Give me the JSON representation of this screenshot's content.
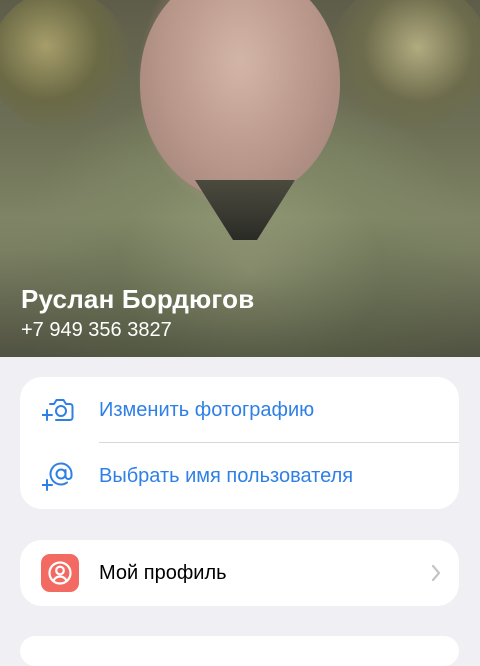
{
  "profile": {
    "name": "Руслан Бордюгов",
    "phone": "+7 949 356 3827"
  },
  "actions": [
    {
      "label": "Изменить фотографию",
      "icon": "add-photo-icon"
    },
    {
      "label": "Выбрать имя пользователя",
      "icon": "at-sign-icon"
    }
  ],
  "menu": [
    {
      "label": "Мой профиль",
      "icon": "person-icon"
    }
  ],
  "colors": {
    "accent": "#2f80e6",
    "background": "#efeff4",
    "profile_icon_bg": "#f36a63"
  }
}
